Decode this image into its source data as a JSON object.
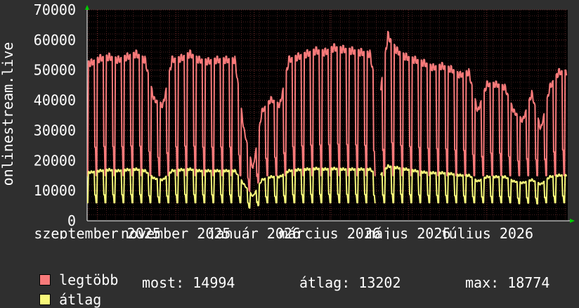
{
  "chart_data": {
    "type": "line",
    "ylabel": "onlinestream.live",
    "ylim": [
      0,
      70000
    ],
    "yticks": [
      0,
      10000,
      20000,
      30000,
      40000,
      50000,
      60000,
      70000
    ],
    "xlim": [
      "2025-08-24",
      "2026-09-02"
    ],
    "xticks": [
      {
        "date": "2025-09-01",
        "label": "szeptember 2025"
      },
      {
        "date": "2025-11-01",
        "label": "november 2025"
      },
      {
        "date": "2026-01-01",
        "label": "január 2026"
      },
      {
        "date": "2026-03-01",
        "label": "március 2026"
      },
      {
        "date": "2026-05-01",
        "label": "május 2026"
      },
      {
        "date": "2026-07-01",
        "label": "július 2026"
      }
    ],
    "grid": true,
    "background": "#000000",
    "series": [
      {
        "name": "legtöbb",
        "color": "#f87a7a",
        "weekly_mean": [
          [
            "2025-08-27",
            52000
          ],
          [
            "2025-09-03",
            53500
          ],
          [
            "2025-09-10",
            54000
          ],
          [
            "2025-09-17",
            53000
          ],
          [
            "2025-09-24",
            54000
          ],
          [
            "2025-10-01",
            55000
          ],
          [
            "2025-10-08",
            53000
          ],
          [
            "2025-10-15",
            40000
          ],
          [
            "2025-10-22",
            38000
          ],
          [
            "2025-10-29",
            53000
          ],
          [
            "2025-11-05",
            53500
          ],
          [
            "2025-11-12",
            55000
          ],
          [
            "2025-11-19",
            53000
          ],
          [
            "2025-11-26",
            52500
          ],
          [
            "2025-12-03",
            53000
          ],
          [
            "2025-12-10",
            53000
          ],
          [
            "2025-12-17",
            53000
          ],
          [
            "2025-12-24",
            30000
          ],
          [
            "2025-12-31",
            17000
          ],
          [
            "2026-01-07",
            36000
          ],
          [
            "2026-01-14",
            40000
          ],
          [
            "2026-01-21",
            38000
          ],
          [
            "2026-01-28",
            53000
          ],
          [
            "2026-02-04",
            54000
          ],
          [
            "2026-02-11",
            55000
          ],
          [
            "2026-02-18",
            56000
          ],
          [
            "2026-02-25",
            55500
          ],
          [
            "2026-03-04",
            57000
          ],
          [
            "2026-03-11",
            56500
          ],
          [
            "2026-03-18",
            56000
          ],
          [
            "2026-03-25",
            55500
          ],
          [
            "2026-04-01",
            55000
          ],
          [
            "2026-04-08",
            39000
          ],
          [
            "2026-04-15",
            61000
          ],
          [
            "2026-04-22",
            56000
          ],
          [
            "2026-04-29",
            54000
          ],
          [
            "2026-05-06",
            53000
          ],
          [
            "2026-05-13",
            52000
          ],
          [
            "2026-05-20",
            50500
          ],
          [
            "2026-05-27",
            51000
          ],
          [
            "2026-06-03",
            50000
          ],
          [
            "2026-06-10",
            48000
          ],
          [
            "2026-06-17",
            49000
          ],
          [
            "2026-06-24",
            36000
          ],
          [
            "2026-07-01",
            45000
          ],
          [
            "2026-07-08",
            45000
          ],
          [
            "2026-07-15",
            44000
          ],
          [
            "2026-07-22",
            36000
          ],
          [
            "2026-07-29",
            33000
          ],
          [
            "2026-08-05",
            42000
          ],
          [
            "2026-08-12",
            30000
          ],
          [
            "2026-08-19",
            44000
          ],
          [
            "2026-08-26",
            49000
          ]
        ],
        "weekend_low": 15000
      },
      {
        "name": "átlag",
        "color": "#f8f87a",
        "weekly_mean": [
          [
            "2025-08-27",
            16000
          ],
          [
            "2025-09-03",
            16500
          ],
          [
            "2025-09-10",
            16800
          ],
          [
            "2025-09-17",
            16500
          ],
          [
            "2025-09-24",
            16800
          ],
          [
            "2025-10-01",
            17000
          ],
          [
            "2025-10-08",
            16500
          ],
          [
            "2025-10-15",
            14000
          ],
          [
            "2025-10-22",
            13500
          ],
          [
            "2025-10-29",
            16500
          ],
          [
            "2025-11-05",
            16800
          ],
          [
            "2025-11-12",
            17000
          ],
          [
            "2025-11-19",
            16500
          ],
          [
            "2025-11-26",
            16500
          ],
          [
            "2025-12-03",
            16500
          ],
          [
            "2025-12-10",
            16500
          ],
          [
            "2025-12-17",
            16500
          ],
          [
            "2025-12-24",
            12000
          ],
          [
            "2025-12-31",
            8000
          ],
          [
            "2026-01-07",
            13500
          ],
          [
            "2026-01-14",
            14500
          ],
          [
            "2026-01-21",
            14500
          ],
          [
            "2026-01-28",
            16500
          ],
          [
            "2026-02-04",
            16800
          ],
          [
            "2026-02-11",
            17000
          ],
          [
            "2026-02-18",
            17200
          ],
          [
            "2026-02-25",
            17000
          ],
          [
            "2026-03-04",
            17200
          ],
          [
            "2026-03-11",
            17000
          ],
          [
            "2026-03-18",
            17000
          ],
          [
            "2026-03-25",
            17000
          ],
          [
            "2026-04-01",
            17000
          ],
          [
            "2026-04-08",
            14500
          ],
          [
            "2026-04-15",
            18000
          ],
          [
            "2026-04-22",
            17500
          ],
          [
            "2026-04-29",
            17000
          ],
          [
            "2026-05-06",
            16500
          ],
          [
            "2026-05-13",
            16000
          ],
          [
            "2026-05-20",
            15800
          ],
          [
            "2026-05-27",
            15800
          ],
          [
            "2026-06-03",
            15500
          ],
          [
            "2026-06-10",
            15000
          ],
          [
            "2026-06-17",
            15000
          ],
          [
            "2026-06-24",
            13000
          ],
          [
            "2026-07-01",
            14500
          ],
          [
            "2026-07-08",
            14500
          ],
          [
            "2026-07-15",
            14500
          ],
          [
            "2026-07-22",
            13000
          ],
          [
            "2026-07-29",
            12500
          ],
          [
            "2026-08-05",
            13500
          ],
          [
            "2026-08-12",
            12000
          ],
          [
            "2026-08-19",
            14500
          ],
          [
            "2026-08-26",
            15000
          ]
        ],
        "weekend_low": 6000
      }
    ],
    "gaps": [
      [
        "2026-04-06",
        "2026-04-09"
      ]
    ]
  },
  "legend": {
    "max_label": "legtöbb",
    "avg_label": "átlag",
    "now": "most: 14994",
    "mean": "átlag: 13202",
    "maximum": "max: 18774"
  }
}
